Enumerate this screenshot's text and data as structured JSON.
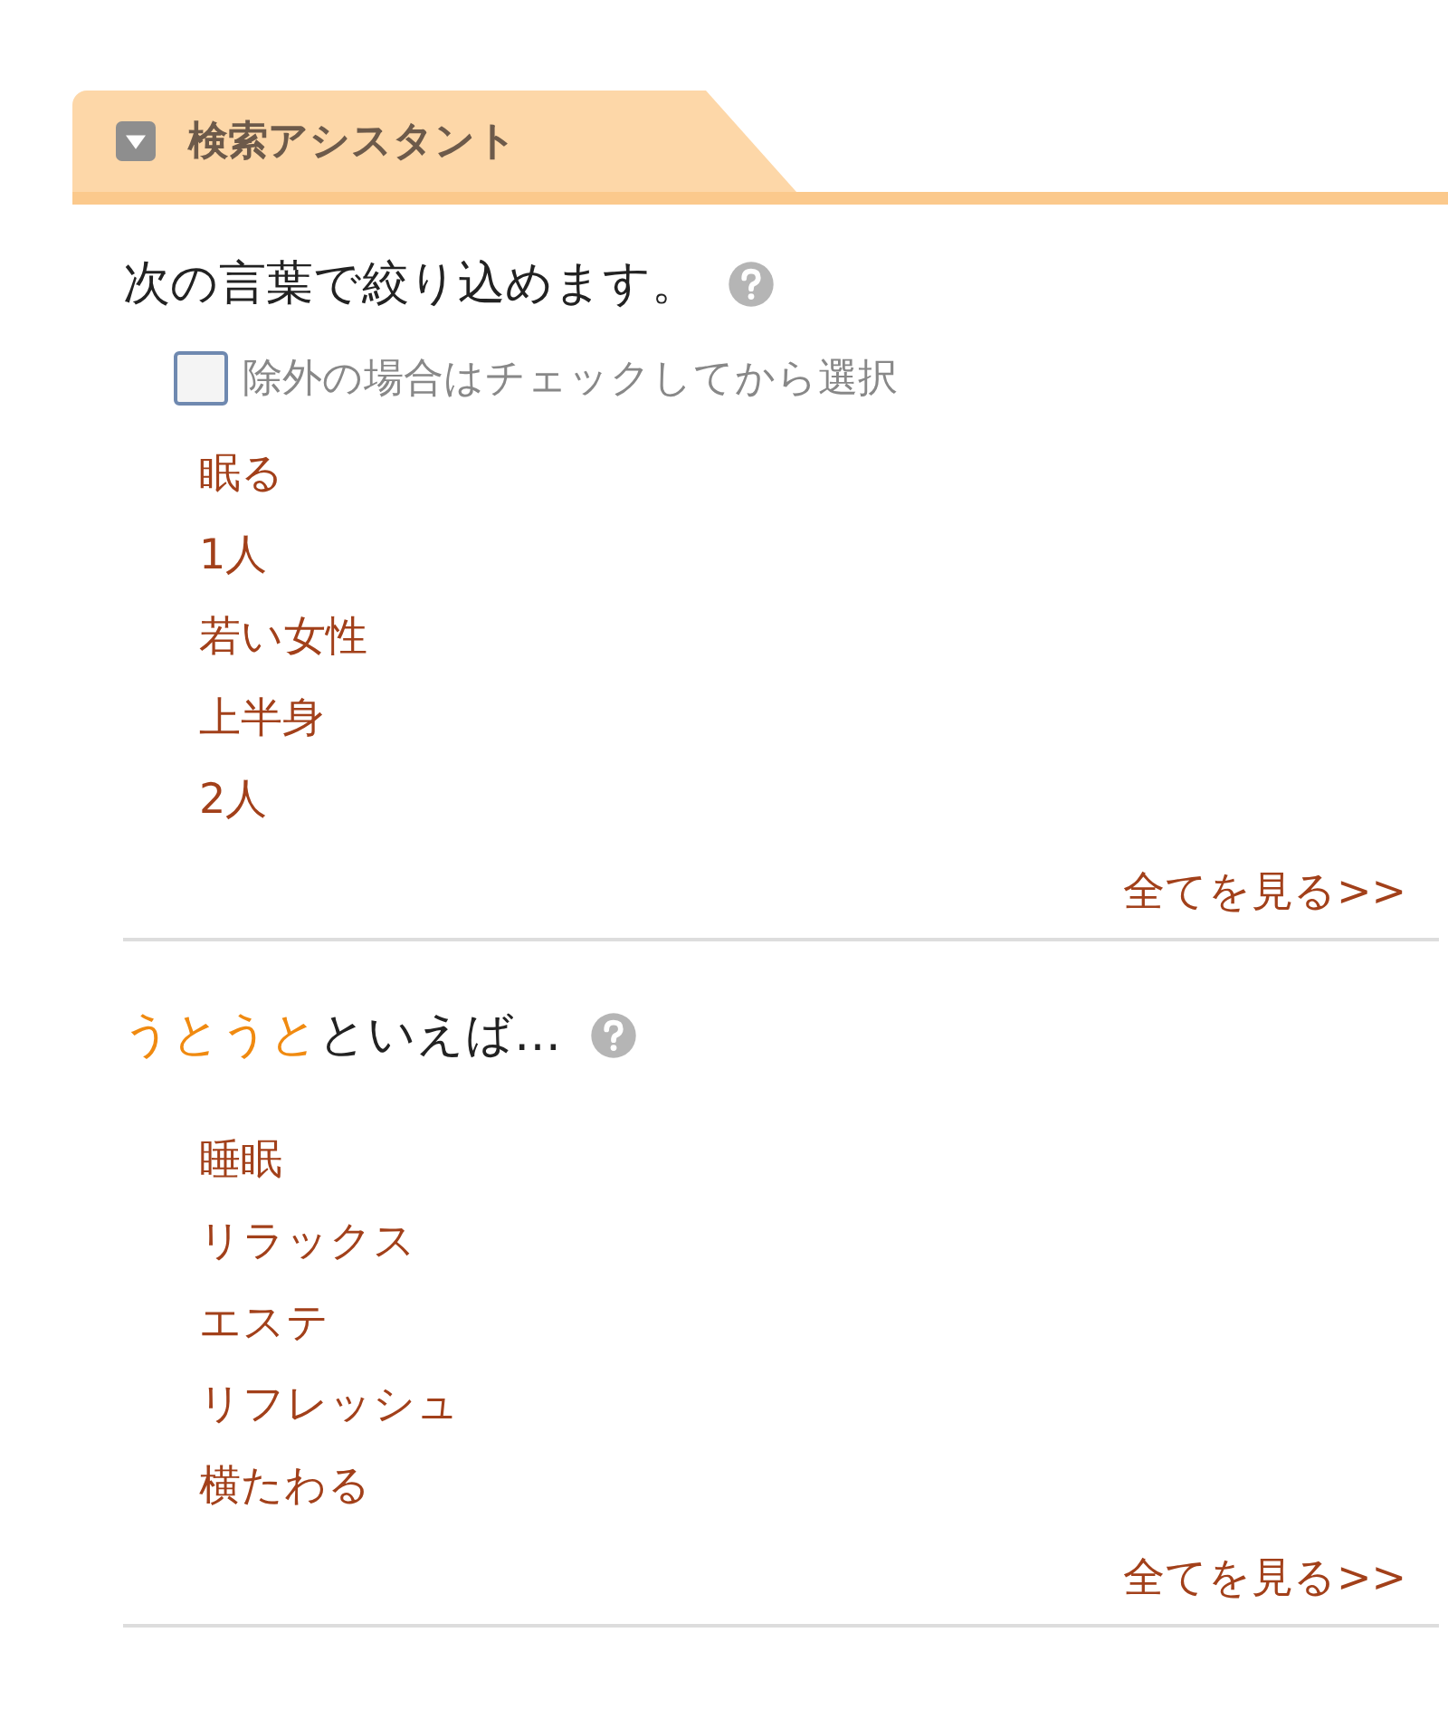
{
  "panel": {
    "title": "検索アシスタント",
    "expanded": true
  },
  "refine": {
    "heading": "次の言葉で絞り込めます。",
    "exclude": {
      "label": "除外の場合はチェックしてから選択",
      "checked": false
    },
    "links": [
      "眠る",
      "1人",
      "若い女性",
      "上半身",
      "2人"
    ],
    "see_all": "全てを見る>>"
  },
  "related": {
    "keyword": "うとうと",
    "heading_suffix": "といえば…",
    "links": [
      "睡眠",
      "リラックス",
      "エステ",
      "リフレッシュ",
      "横たわる"
    ],
    "see_all": "全てを見る>>"
  }
}
